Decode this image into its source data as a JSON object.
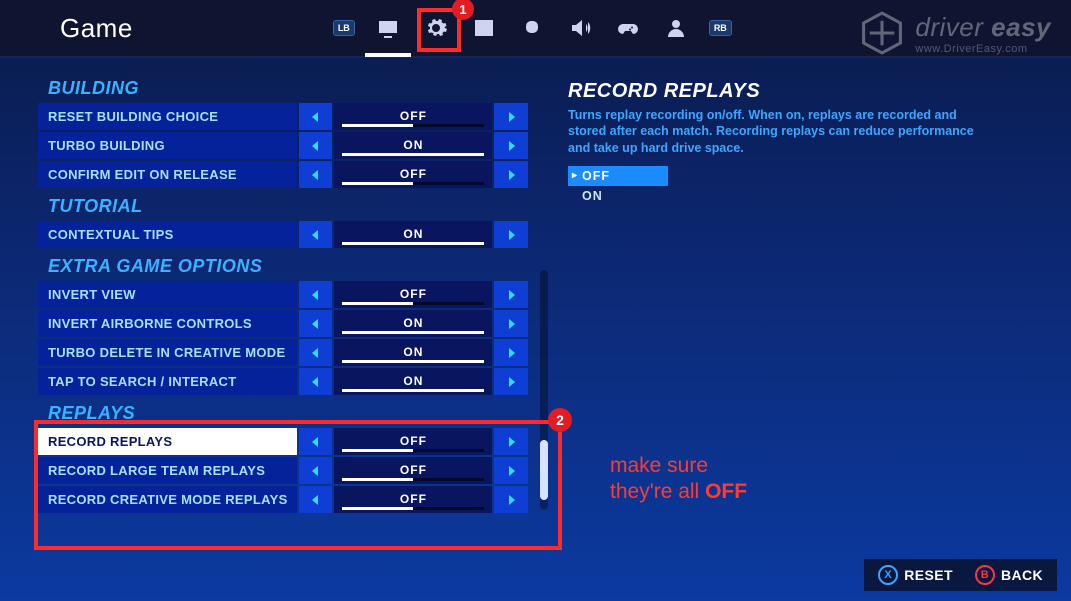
{
  "header": {
    "title": "Game",
    "lb": "LB",
    "rb": "RB"
  },
  "brand": {
    "name_light": "driver",
    "name_bold": "easy",
    "url": "www.DriverEasy.com"
  },
  "annotations": {
    "gear_badge": "1",
    "replays_badge": "2",
    "hint_line1": "make sure",
    "hint_line2_a": "they're all ",
    "hint_line2_b": "OFF"
  },
  "sections": [
    {
      "title": "BUILDING",
      "rows": [
        {
          "label": "RESET BUILDING CHOICE",
          "value": "OFF",
          "fill": "off"
        },
        {
          "label": "TURBO BUILDING",
          "value": "ON",
          "fill": "on"
        },
        {
          "label": "CONFIRM EDIT ON RELEASE",
          "value": "OFF",
          "fill": "off"
        }
      ]
    },
    {
      "title": "TUTORIAL",
      "rows": [
        {
          "label": "CONTEXTUAL TIPS",
          "value": "ON",
          "fill": "on"
        }
      ]
    },
    {
      "title": "EXTRA GAME OPTIONS",
      "rows": [
        {
          "label": "INVERT VIEW",
          "value": "OFF",
          "fill": "off"
        },
        {
          "label": "INVERT AIRBORNE CONTROLS",
          "value": "ON",
          "fill": "on"
        },
        {
          "label": "TURBO DELETE IN CREATIVE MODE",
          "value": "ON",
          "fill": "on"
        },
        {
          "label": "TAP TO SEARCH / INTERACT",
          "value": "ON",
          "fill": "on"
        }
      ]
    },
    {
      "title": "REPLAYS",
      "rows": [
        {
          "label": "RECORD REPLAYS",
          "value": "OFF",
          "fill": "off",
          "selected": true
        },
        {
          "label": "RECORD LARGE TEAM REPLAYS",
          "value": "OFF",
          "fill": "off"
        },
        {
          "label": "RECORD CREATIVE MODE REPLAYS",
          "value": "OFF",
          "fill": "off"
        }
      ]
    }
  ],
  "detail": {
    "title": "RECORD REPLAYS",
    "description": "Turns replay recording on/off. When on, replays are recorded and stored after each match. Recording replays can reduce performance and take up hard drive space.",
    "options": [
      {
        "label": "OFF",
        "selected": true
      },
      {
        "label": "ON",
        "selected": false
      }
    ]
  },
  "footer": {
    "reset_key": "X",
    "reset_label": "RESET",
    "back_key": "B",
    "back_label": "BACK"
  }
}
